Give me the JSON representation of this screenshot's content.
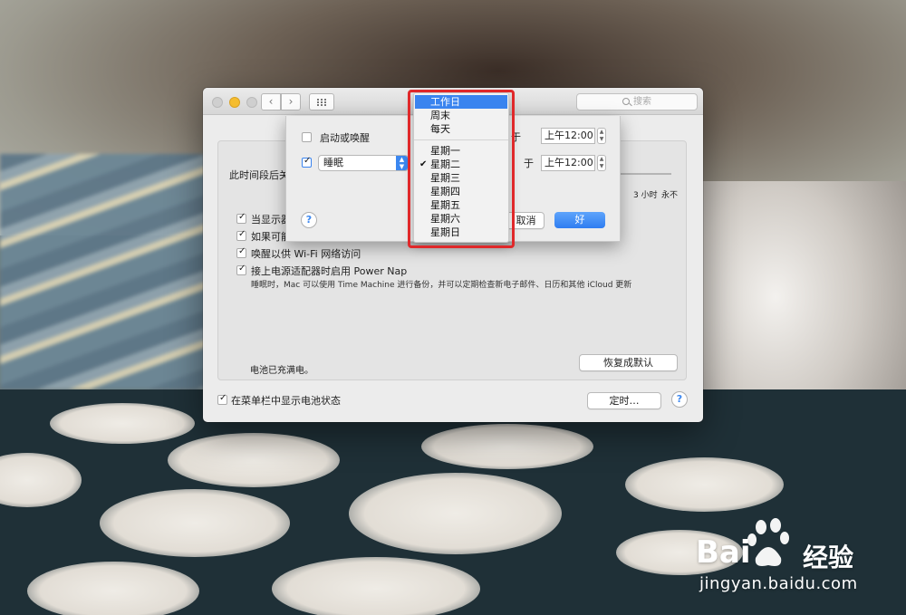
{
  "window": {
    "search_placeholder": "搜索",
    "nav_back": "‹",
    "nav_forward": "›"
  },
  "panel": {
    "turn_off_label": "此时间段后关",
    "slider_labels": [
      "3 小时",
      "永不"
    ],
    "options": [
      {
        "label": "当显示器",
        "checked": true
      },
      {
        "label": "如果可能",
        "checked": true
      },
      {
        "label": "唤醒以供 Wi-Fi 网络访问",
        "checked": true
      },
      {
        "label": "接上电源适配器时启用 Power Nap",
        "checked": true
      }
    ],
    "power_nap_desc": "睡眠时，Mac 可以使用 Time Machine 进行备份，并可以定期检查新电子邮件、日历和其他 iCloud 更新",
    "battery_status": "电池已充满电。",
    "restore_defaults": "恢复成默认"
  },
  "footer": {
    "show_battery_label": "在菜单栏中显示电池状态",
    "show_battery_checked": true,
    "schedule_button": "定时…",
    "help": "?"
  },
  "sheet": {
    "start_or_wake_label": "启动或唤醒",
    "start_or_wake_checked": false,
    "sleep_checked": true,
    "sleep_value": "睡眠",
    "at_label": "于",
    "time_1": "上午12:00",
    "time_2": "上午12:00",
    "cancel": "取消",
    "ok": "好",
    "help": "?"
  },
  "menu": {
    "group_1": [
      "工作日",
      "周末",
      "每天"
    ],
    "group_2": [
      "星期一",
      "星期二",
      "星期三",
      "星期四",
      "星期五",
      "星期六",
      "星期日"
    ],
    "selected": "工作日",
    "checked": "星期二"
  },
  "watermark": {
    "brand": "Bai",
    "brand_suffix": "经验",
    "url": "jingyan.baidu.com"
  },
  "colors": {
    "accent": "#3a84ef",
    "highlight": "#e0282a",
    "minimize": "#f5bd2f"
  }
}
